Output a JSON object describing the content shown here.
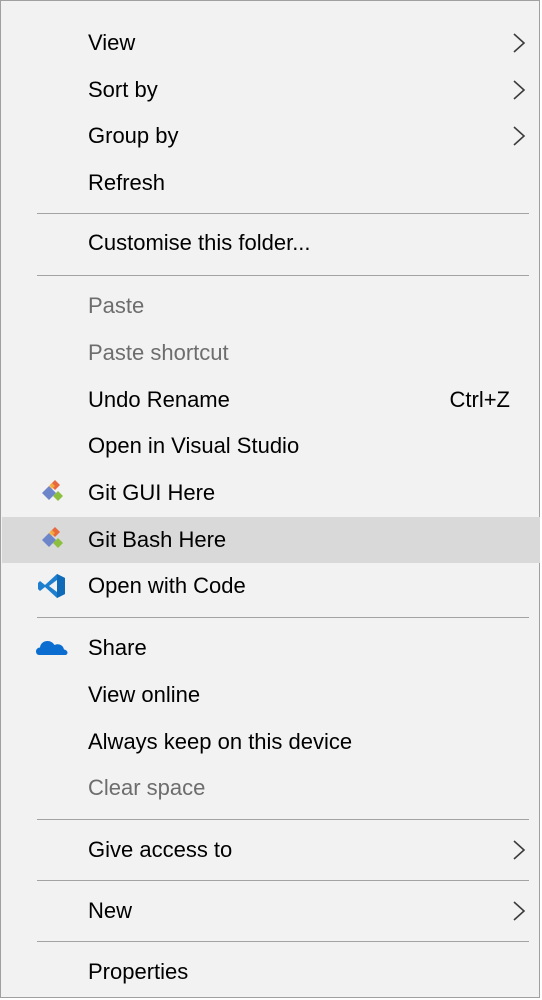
{
  "menu": {
    "items": [
      {
        "label": "View",
        "has_submenu": true
      },
      {
        "label": "Sort by",
        "has_submenu": true
      },
      {
        "label": "Group by",
        "has_submenu": true
      },
      {
        "label": "Refresh"
      },
      {
        "label": "Customise this folder..."
      },
      {
        "label": "Paste",
        "disabled": true
      },
      {
        "label": "Paste shortcut",
        "disabled": true
      },
      {
        "label": "Undo Rename",
        "shortcut": "Ctrl+Z"
      },
      {
        "label": "Open in Visual Studio"
      },
      {
        "label": "Git GUI Here",
        "icon": "git-gui-icon"
      },
      {
        "label": "Git Bash Here",
        "icon": "git-bash-icon",
        "highlighted": true
      },
      {
        "label": "Open with Code",
        "icon": "vscode-icon"
      },
      {
        "label": "Share",
        "icon": "onedrive-cloud-icon"
      },
      {
        "label": "View online"
      },
      {
        "label": "Always keep on this device"
      },
      {
        "label": "Clear space",
        "disabled": true
      },
      {
        "label": "Give access to",
        "has_submenu": true
      },
      {
        "label": "New",
        "has_submenu": true
      },
      {
        "label": "Properties"
      }
    ]
  },
  "colors": {
    "menu_background": "#f2f2f2",
    "highlight_background": "#d9d9d9",
    "disabled_text": "#6d6d6d",
    "separator": "#a3a3a3"
  }
}
